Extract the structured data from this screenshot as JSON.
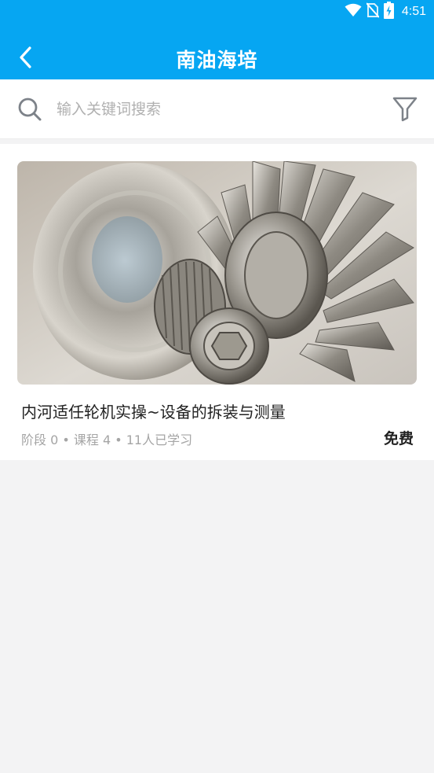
{
  "status_bar": {
    "time": "4:51",
    "icons": [
      "wifi-icon",
      "no-sim-icon",
      "battery-charging-icon"
    ]
  },
  "header": {
    "title": "南油海培",
    "back_icon": "chevron-left-icon"
  },
  "search": {
    "placeholder": "输入关键词搜索",
    "value": "",
    "search_icon": "search-icon",
    "filter_icon": "filter-icon"
  },
  "courses": [
    {
      "title": "内河适任轮机实操~设备的拆装与测量",
      "meta": "阶段 0 • 课程 4 • 11人已学习",
      "price": "免费",
      "image": "turbine-impeller-image"
    }
  ],
  "colors": {
    "header_bg": "#06a6f2",
    "page_bg": "#f3f3f4",
    "card_bg": "#ffffff"
  }
}
